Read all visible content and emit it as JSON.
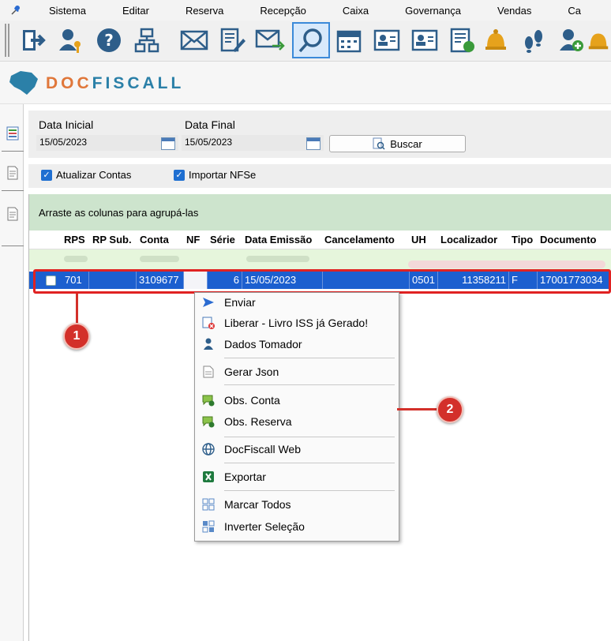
{
  "menu": {
    "items": [
      "Sistema",
      "Editar",
      "Reserva",
      "Recepção",
      "Caixa",
      "Governança",
      "Vendas",
      "Ca"
    ]
  },
  "toolbar": {
    "buttons": [
      "exit-icon",
      "user-key-icon",
      "help-icon",
      "tree-icon",
      "mail-icon",
      "doc-edit-icon",
      "send-mail-icon",
      "search-icon",
      "calendar-icon",
      "card-icon",
      "card2-icon",
      "report-icon",
      "bell-icon",
      "footprints-icon",
      "add-user-icon",
      "bell2-icon"
    ],
    "active": "search-icon"
  },
  "logo": {
    "text_a": "DOC",
    "text_b": "FISCALL"
  },
  "filters": {
    "data_inicial_label": "Data Inicial",
    "data_inicial_value": "15/05/2023",
    "data_final_label": "Data Final",
    "data_final_value": "15/05/2023",
    "buscar_label": "Buscar",
    "atualizar_contas_label": "Atualizar Contas",
    "atualizar_contas_checked": true,
    "importar_nfse_label": "Importar NFSe",
    "importar_nfse_checked": true
  },
  "grid": {
    "group_hint": "Arraste as colunas para agrupá-las",
    "columns": [
      "RPS",
      "RP Sub.",
      "Conta",
      "NF",
      "Série",
      "Data Emissão",
      "Cancelamento",
      "UH",
      "Localizador",
      "Tipo",
      "Documento"
    ],
    "selected_row": {
      "rps": "701",
      "rp_sub": "",
      "conta": "3109677",
      "nf": "",
      "serie": "6",
      "data_emissao": "15/05/2023",
      "cancelamento": "",
      "uh": "0501",
      "localizador": "11358211",
      "tipo": "F",
      "documento": "17001773034"
    }
  },
  "context_menu": {
    "items": [
      {
        "label": "Enviar",
        "icon": "send-arrow-icon"
      },
      {
        "label": "Liberar - Livro ISS já Gerado!",
        "icon": "release-icon"
      },
      {
        "label": "Dados Tomador",
        "icon": "person-icon"
      },
      {
        "label": "Gerar Json",
        "icon": "json-file-icon"
      },
      {
        "label": "Obs. Conta",
        "icon": "note-icon"
      },
      {
        "label": "Obs. Reserva",
        "icon": "note-icon"
      },
      {
        "label": "DocFiscall Web",
        "icon": "globe-icon"
      },
      {
        "label": "Exportar",
        "icon": "excel-icon"
      },
      {
        "label": "Marcar Todos",
        "icon": "grid-check-icon"
      },
      {
        "label": "Inverter Seleção",
        "icon": "invert-selection-icon"
      }
    ]
  },
  "annotations": {
    "badge1": "1",
    "badge2": "2"
  },
  "colors": {
    "selection": "#1c5fcf",
    "highlight": "#fbfb2e",
    "annotation": "#d3302a",
    "group_bar": "#cde4cd"
  }
}
